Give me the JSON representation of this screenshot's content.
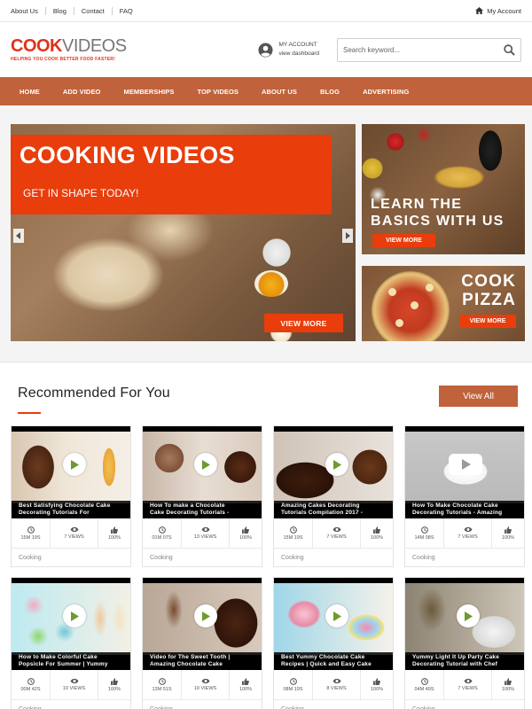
{
  "topbar": {
    "links": [
      "About Us",
      "Blog",
      "Contact",
      "FAQ"
    ],
    "account_label": "My Account"
  },
  "logo": {
    "part1": "COOK",
    "part2": "VIDEOS",
    "tagline": "HELPING YOU COOK BETTER FOOD FASTER!"
  },
  "my_account": {
    "title": "MY ACCOUNT",
    "subtitle": "view dashboard"
  },
  "search": {
    "placeholder": "Search keyword..."
  },
  "nav": [
    "HOME",
    "ADD VIDEO",
    "MEMBERSHIPS",
    "TOP VIDEOS",
    "ABOUT US",
    "BLOG",
    "ADVERTISING"
  ],
  "hero": {
    "headline": "COOKING VIDEOS",
    "subheadline": "GET IN SHAPE TODAY!",
    "button": "VIEW MORE"
  },
  "side_banner_1": {
    "title_line1": "LEARN THE",
    "title_line2": "BASICS WITH US",
    "button": "VIEW MORE"
  },
  "side_banner_2": {
    "title_line1": "COOK",
    "title_line2": "PIZZA",
    "button": "VIEW MORE"
  },
  "recommended": {
    "title": "Recommended For You",
    "view_all": "View All",
    "videos": [
      {
        "title1": "Best Satisfying Chocolate Cake",
        "title2": "Decorating Tutorials For",
        "duration": "15M 19S",
        "views": "7 VIEWS",
        "rating": "100%",
        "category": "Cooking",
        "theme": "choc1"
      },
      {
        "title1": "How To make a Chocolate",
        "title2": "Cake Decorating Tutorials -",
        "duration": "01M 07S",
        "views": "13 VIEWS",
        "rating": "100%",
        "category": "Cooking",
        "theme": "choc2"
      },
      {
        "title1": "Amazing Cakes Decorating",
        "title2": "Tutorials Compilation 2017 -",
        "duration": "15M 19S",
        "views": "7 VIEWS",
        "rating": "100%",
        "category": "Cooking",
        "theme": "choc3"
      },
      {
        "title1": "How To Make Chocolate Cake",
        "title2": "Decorating Tutorials - Amazing",
        "duration": "14M 08S",
        "views": "7 VIEWS",
        "rating": "100%",
        "category": "Cooking",
        "theme": "gray"
      },
      {
        "title1": "How to Make Colorful Cake",
        "title2": "Popsicle For Summer | Yummy",
        "duration": "00M 42S",
        "views": "10 VIEWS",
        "rating": "100%",
        "category": "Cooking",
        "theme": "pops"
      },
      {
        "title1": "Video for The Sweet Tooth |",
        "title2": "Amazing Chocolate Cake",
        "duration": "13M 51S",
        "views": "10 VIEWS",
        "rating": "100%",
        "category": "Cooking",
        "theme": "choc4"
      },
      {
        "title1": "Best Yummy Chocolate Cake",
        "title2": "Recipes | Quick and Easy Cake",
        "duration": "08M 19S",
        "views": "8 VIEWS",
        "rating": "100%",
        "category": "Cooking",
        "theme": "rainbow"
      },
      {
        "title1": "Yummy Light It Up Party Cake",
        "title2": "Decorating Tutorial with Chef",
        "duration": "04M 49S",
        "views": "7 VIEWS",
        "rating": "100%",
        "category": "Cooking",
        "theme": "party"
      }
    ]
  }
}
